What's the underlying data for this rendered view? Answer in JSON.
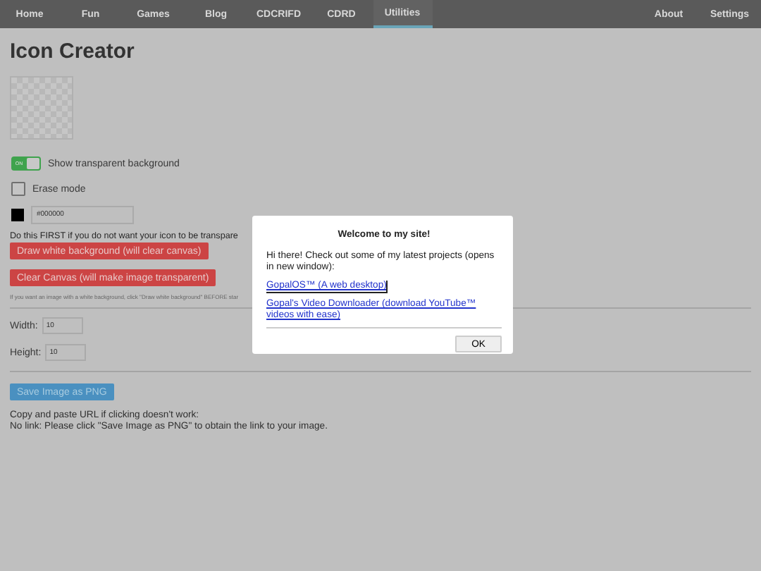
{
  "nav": {
    "left": [
      {
        "label": "Home",
        "selected": false
      },
      {
        "label": "Fun",
        "selected": false
      },
      {
        "label": "Games",
        "selected": false
      },
      {
        "label": "Blog",
        "selected": false
      },
      {
        "label": "CDCRIFD",
        "selected": false
      },
      {
        "label": "CDRD",
        "selected": false
      },
      {
        "label": "Utilities",
        "selected": true
      }
    ],
    "right": [
      {
        "label": "About",
        "selected": false
      },
      {
        "label": "Settings",
        "selected": false
      }
    ]
  },
  "title": "Icon Creator",
  "transparent_toggle": {
    "on": true,
    "switch_text": "ON",
    "label": "Show transparent background"
  },
  "erase_mode": {
    "checked": false,
    "label": "Erase mode"
  },
  "color": {
    "value": "#000000"
  },
  "first_note": "Do this FIRST if you do not want your icon to be transpare",
  "draw_white_button": "Draw white background (will clear canvas)",
  "clear_button": "Clear Canvas (will make image transparent)",
  "small_note": "If you want an image with a white background, click \"Draw white background\" BEFORE star",
  "width": {
    "label": "Width:",
    "value": "10"
  },
  "height": {
    "label": "Height:",
    "value": "10"
  },
  "save_button": "Save Image as PNG",
  "url_note": "Copy and paste URL if clicking doesn't work:",
  "link_note": "No link: Please click \"Save Image as PNG\" to obtain the link to your image.",
  "dialog": {
    "title": "Welcome to my site!",
    "message": "Hi there! Check out some of my latest projects (opens in new window):",
    "links": [
      {
        "text": "GopalOS™ (A web desktop)",
        "focused": true
      },
      {
        "text": "Gopal's Video Downloader (download YouTube™ videos with ease)",
        "focused": false
      }
    ],
    "ok_button": "OK"
  }
}
